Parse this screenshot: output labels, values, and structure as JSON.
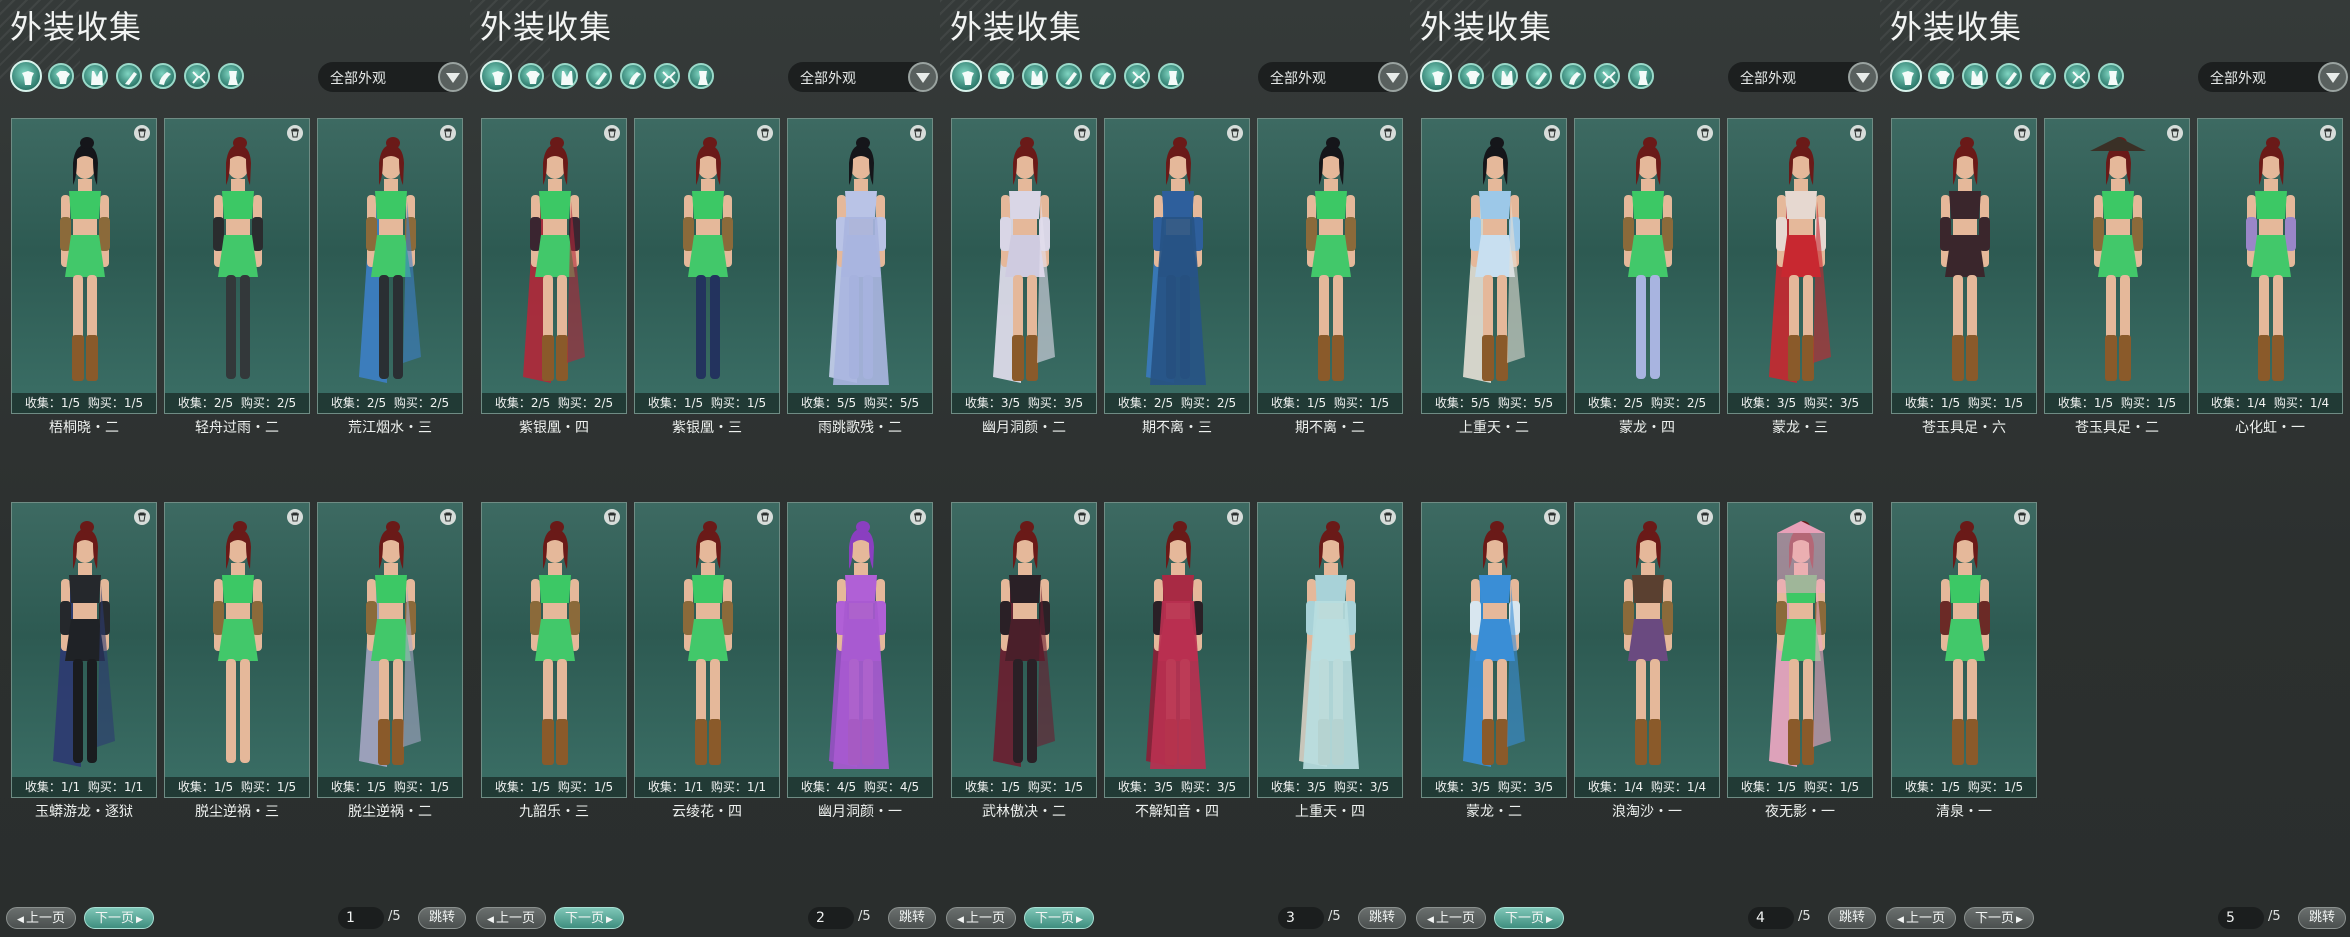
{
  "panel_title": "外装收集",
  "filter_label": "全部外观",
  "stats_prefix_collect": "收集：",
  "stats_prefix_buy": "购买：",
  "prev_label": "上一页",
  "next_label": "下一页",
  "jump_label": "跳转",
  "page_total": "/5",
  "category_icons": [
    "outfit-icon",
    "top-icon",
    "robe-icon",
    "pants-icon",
    "shoes-icon",
    "gloves-icon",
    "legwear-icon"
  ],
  "colors": {
    "accent_teal": "#3f8e7f",
    "card_bg": "#2d5a52",
    "skin": "#e5b89a",
    "hair": "#6a1a18",
    "outfit_green": "#38c060"
  },
  "panels": [
    {
      "page": "1",
      "next_active": true,
      "items": [
        {
          "name": "梧桐晓・二",
          "collect": "1/5",
          "buy": "1/5",
          "outfit": "green",
          "hair": "black"
        },
        {
          "name": "轻舟过雨・二",
          "collect": "2/5",
          "buy": "2/5",
          "outfit": "green-black-legs",
          "hair": "red"
        },
        {
          "name": "荒江烟水・三",
          "collect": "2/5",
          "buy": "2/5",
          "outfit": "green-blue-cape",
          "hair": "red"
        },
        {
          "name": "玉蟒游龙・逐狱",
          "collect": "1/1",
          "buy": "1/1",
          "outfit": "black",
          "hair": "red"
        },
        {
          "name": "脱尘逆祸・三",
          "collect": "1/5",
          "buy": "1/5",
          "outfit": "green-barefoot",
          "hair": "red"
        },
        {
          "name": "脱尘逆祸・二",
          "collect": "1/5",
          "buy": "1/5",
          "outfit": "green-cape-grey",
          "hair": "red"
        }
      ]
    },
    {
      "page": "2",
      "next_active": true,
      "items": [
        {
          "name": "紫银凰・四",
          "collect": "2/5",
          "buy": "2/5",
          "outfit": "green-red-cape",
          "hair": "red"
        },
        {
          "name": "紫银凰・三",
          "collect": "1/5",
          "buy": "1/5",
          "outfit": "green-blue-leg",
          "hair": "red"
        },
        {
          "name": "雨跳歌残・二",
          "collect": "5/5",
          "buy": "5/5",
          "outfit": "lavender-robe",
          "hair": "black"
        },
        {
          "name": "九韶乐・三",
          "collect": "1/5",
          "buy": "1/5",
          "outfit": "green-belt",
          "hair": "red"
        },
        {
          "name": "云绫花・四",
          "collect": "1/1",
          "buy": "1/1",
          "outfit": "green-flower",
          "hair": "red"
        },
        {
          "name": "幽月洞颜・一",
          "collect": "4/5",
          "buy": "4/5",
          "outfit": "purple-dress",
          "hair": "purple"
        }
      ]
    },
    {
      "page": "3",
      "next_active": true,
      "items": [
        {
          "name": "幽月洞颜・二",
          "collect": "3/5",
          "buy": "3/5",
          "outfit": "white-dress",
          "hair": "red"
        },
        {
          "name": "期不离・三",
          "collect": "2/5",
          "buy": "2/5",
          "outfit": "blue-armor",
          "hair": "red"
        },
        {
          "name": "期不离・二",
          "collect": "1/5",
          "buy": "1/5",
          "outfit": "green",
          "hair": "black"
        },
        {
          "name": "武林傲决・二",
          "collect": "1/5",
          "buy": "1/5",
          "outfit": "dark-red",
          "hair": "red"
        },
        {
          "name": "不解知音・四",
          "collect": "3/5",
          "buy": "3/5",
          "outfit": "crimson-dress",
          "hair": "red"
        },
        {
          "name": "上重天・四",
          "collect": "3/5",
          "buy": "3/5",
          "outfit": "light-blue-dress",
          "hair": "red"
        }
      ]
    },
    {
      "page": "4",
      "next_active": true,
      "items": [
        {
          "name": "上重天・二",
          "collect": "5/5",
          "buy": "5/5",
          "outfit": "lightblue-white",
          "hair": "black"
        },
        {
          "name": "蒙龙・四",
          "collect": "2/5",
          "buy": "2/5",
          "outfit": "green-lavender",
          "hair": "red"
        },
        {
          "name": "蒙龙・三",
          "collect": "3/5",
          "buy": "3/5",
          "outfit": "red-white",
          "hair": "red"
        },
        {
          "name": "蒙龙・二",
          "collect": "3/5",
          "buy": "3/5",
          "outfit": "blue-white",
          "hair": "red"
        },
        {
          "name": "浪淘沙・一",
          "collect": "1/4",
          "buy": "1/4",
          "outfit": "brown-sash",
          "hair": "red"
        },
        {
          "name": "夜无影・一",
          "collect": "1/5",
          "buy": "1/5",
          "outfit": "green-pink-veil",
          "hair": "pink-hat"
        }
      ]
    },
    {
      "page": "5",
      "next_active": false,
      "items": [
        {
          "name": "苍玉具足・六",
          "collect": "1/5",
          "buy": "1/5",
          "outfit": "black-dress",
          "hair": "red"
        },
        {
          "name": "苍玉具足・二",
          "collect": "1/5",
          "buy": "1/5",
          "outfit": "green-straw-hat",
          "hair": "hat"
        },
        {
          "name": "心化虹・一",
          "collect": "1/4",
          "buy": "1/4",
          "outfit": "green-purple-sleeve",
          "hair": "red"
        },
        {
          "name": "清泉・一",
          "collect": "1/5",
          "buy": "1/5",
          "outfit": "green-red-gloves",
          "hair": "red"
        }
      ]
    }
  ]
}
